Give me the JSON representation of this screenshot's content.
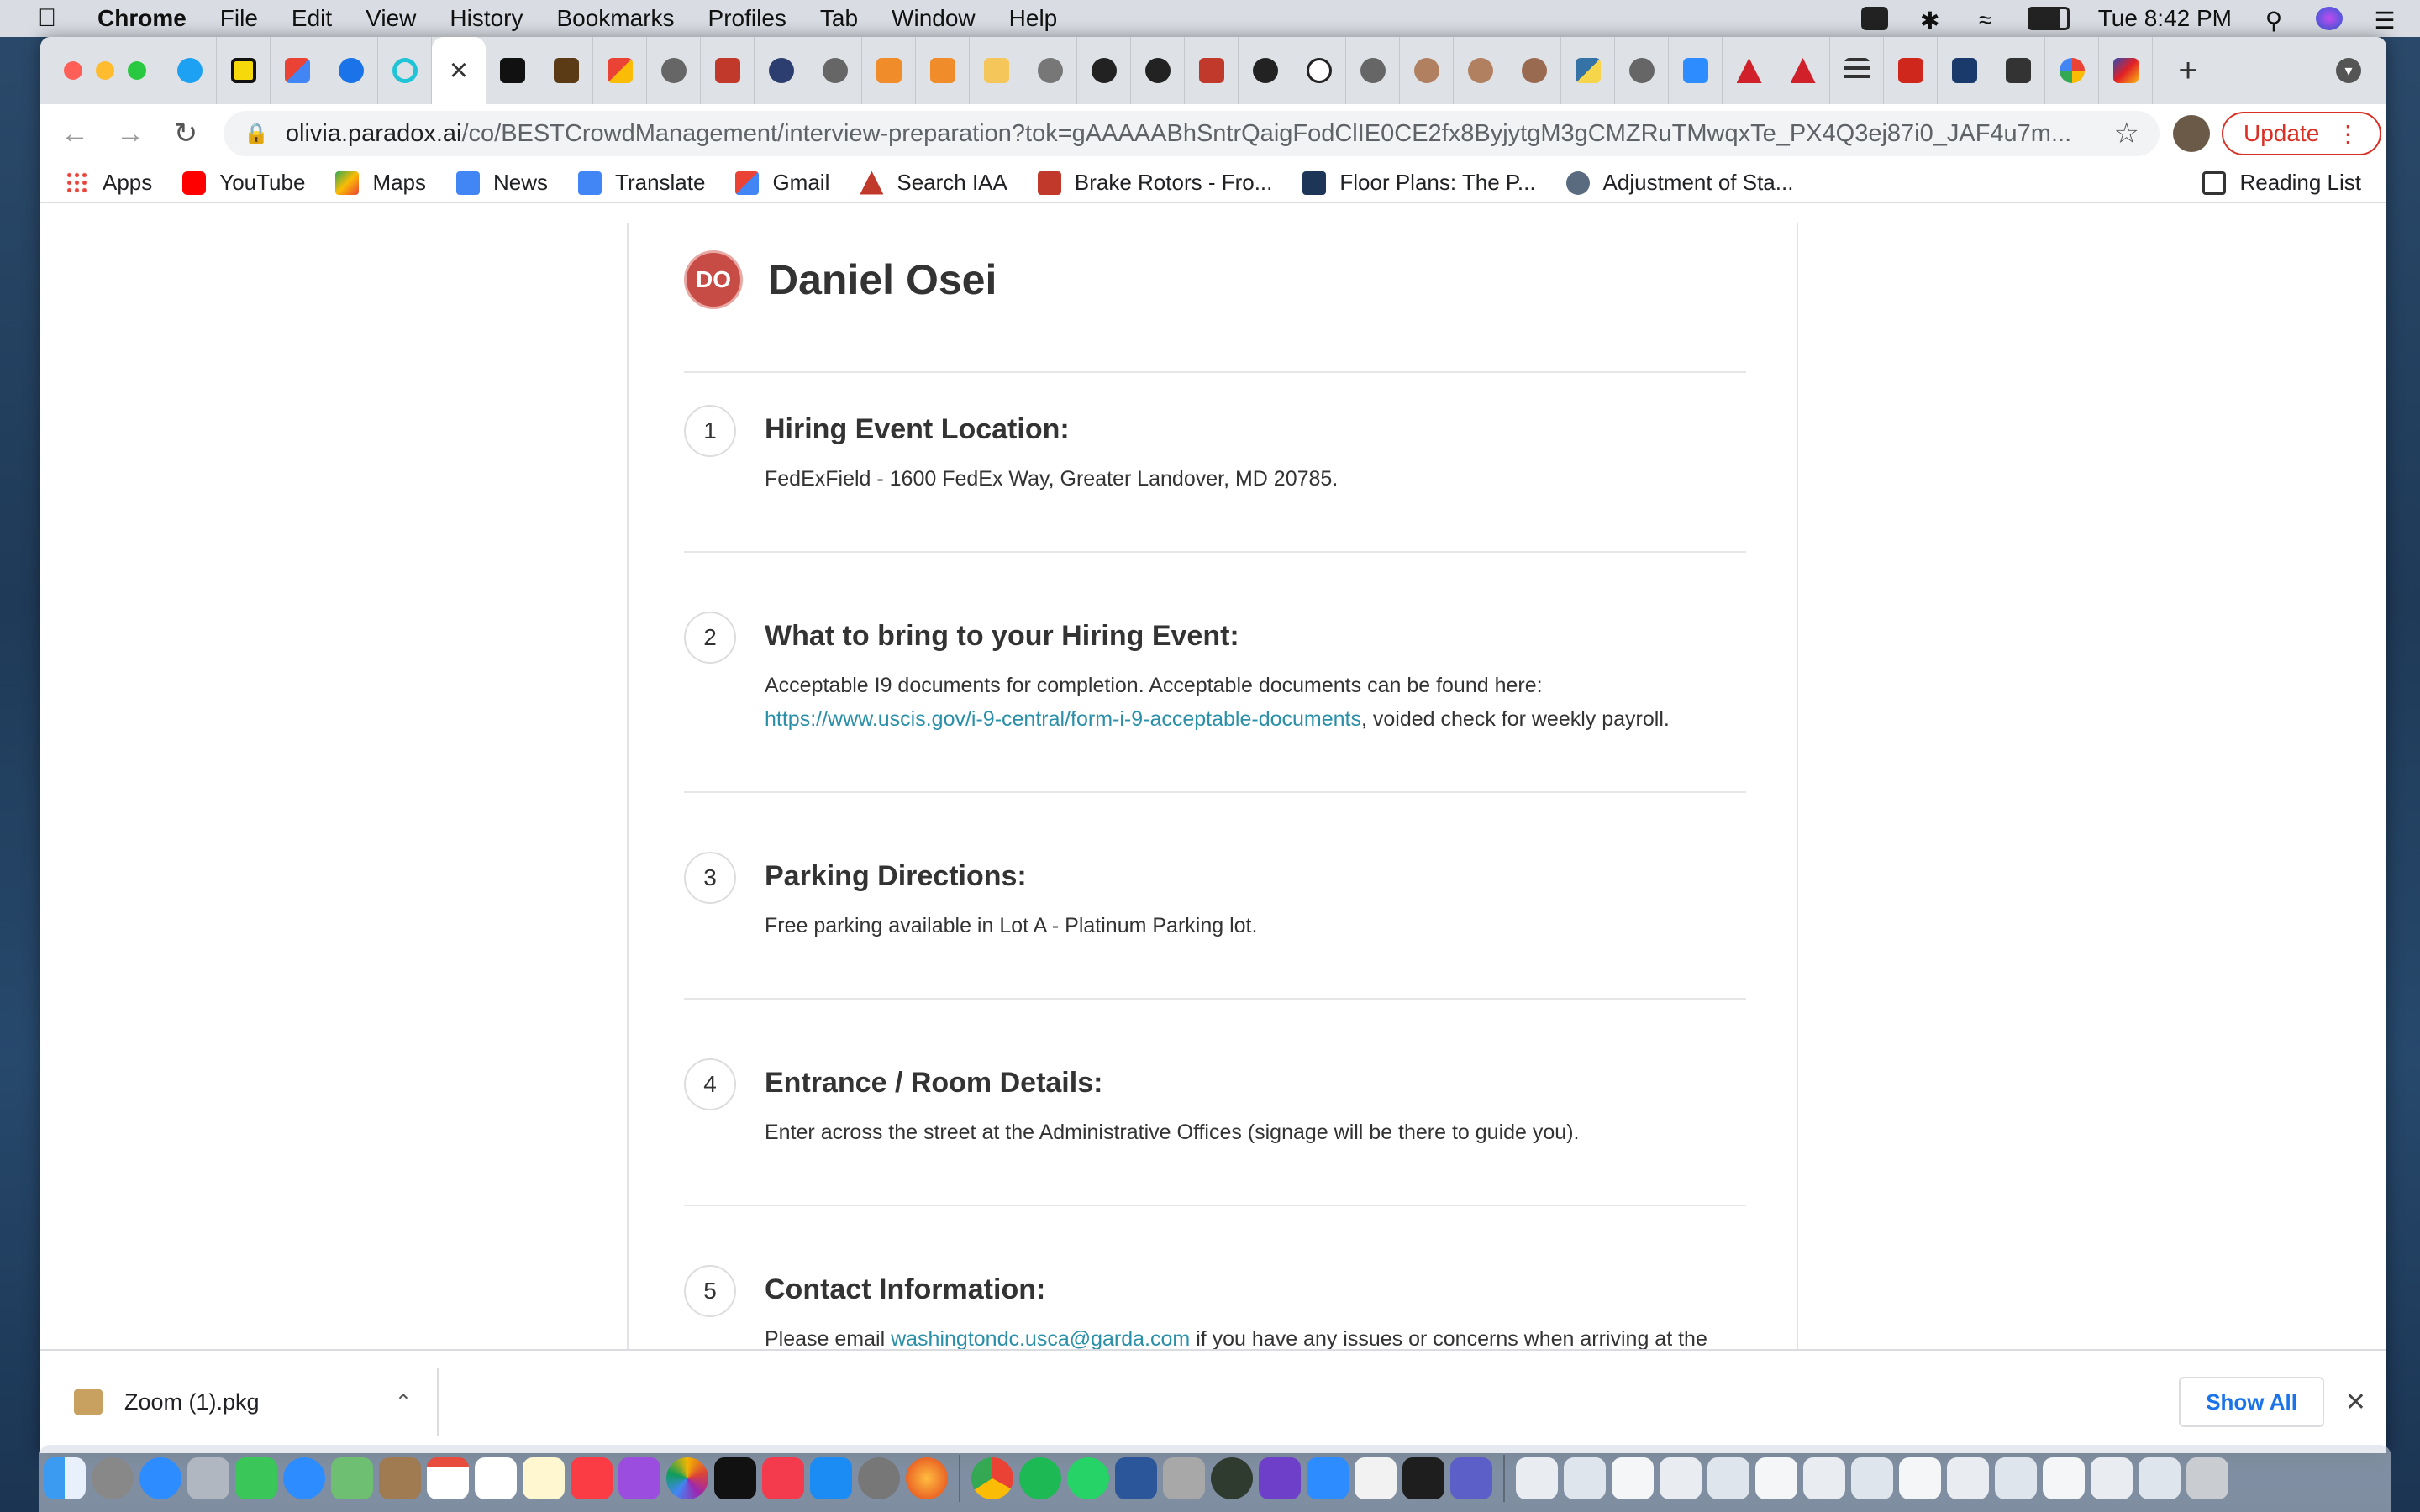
{
  "menubar": {
    "app": "Chrome",
    "items": [
      "File",
      "Edit",
      "View",
      "History",
      "Bookmarks",
      "Profiles",
      "Tab",
      "Window",
      "Help"
    ],
    "clock": "Tue 8:42 PM"
  },
  "browser": {
    "close_tab_glyph": "×",
    "url_host": "olivia.paradox.ai",
    "url_path": "/co/BESTCrowdManagement/interview-preparation?tok=gAAAAABhSntrQaigFodClIE0CE2fx8ByjytgM3gCMZRuTMwqxTe_PX4Q3ej87i0_JAF4u7m...",
    "update_label": "Update",
    "bookmarks": [
      {
        "label": "Apps",
        "color": "#e8453c"
      },
      {
        "label": "YouTube",
        "color": "#ff0000"
      },
      {
        "label": "Maps",
        "color": "#34a853"
      },
      {
        "label": "News",
        "color": "#4285f4"
      },
      {
        "label": "Translate",
        "color": "#4285f4"
      },
      {
        "label": "Gmail",
        "color": "#ea4335"
      },
      {
        "label": "Search IAA",
        "color": "#c0392b"
      },
      {
        "label": "Brake Rotors - Fro...",
        "color": "#c0392b"
      },
      {
        "label": "Floor Plans: The P...",
        "color": "#1d3557"
      },
      {
        "label": "Adjustment of Sta...",
        "color": "#5a6b80"
      }
    ],
    "reading_list": "Reading List"
  },
  "page": {
    "person": {
      "initials": "DO",
      "name": "Daniel Osei"
    },
    "steps": [
      {
        "num": "1",
        "title": "Hiring Event Location:",
        "body": "FedExField - 1600 FedEx Way, Greater Landover, MD 20785."
      },
      {
        "num": "2",
        "title": "What to bring to your Hiring Event:",
        "body_before": "Acceptable I9 documents for completion. Acceptable documents can be found here:",
        "link": "https://www.uscis.gov/i-9-central/form-i-9-acceptable-documents",
        "body_after": ", voided check for weekly payroll."
      },
      {
        "num": "3",
        "title": "Parking Directions:",
        "body": "Free parking available in Lot A - Platinum Parking lot."
      },
      {
        "num": "4",
        "title": "Entrance / Room Details:",
        "body": "Enter across the street at the Administrative Offices (signage will be there to guide you)."
      },
      {
        "num": "5",
        "title": "Contact Information:",
        "body_before": "Please email",
        "link": "washingtondc.usca@garda.com",
        "body_after": "if you have any issues or concerns when arriving at the"
      }
    ]
  },
  "downloads": {
    "file": "Zoom (1).pkg",
    "show_all": "Show All"
  },
  "colors": {
    "accent_link": "#2a8fa8",
    "avatar": "#c84c46",
    "update": "#d93025"
  }
}
